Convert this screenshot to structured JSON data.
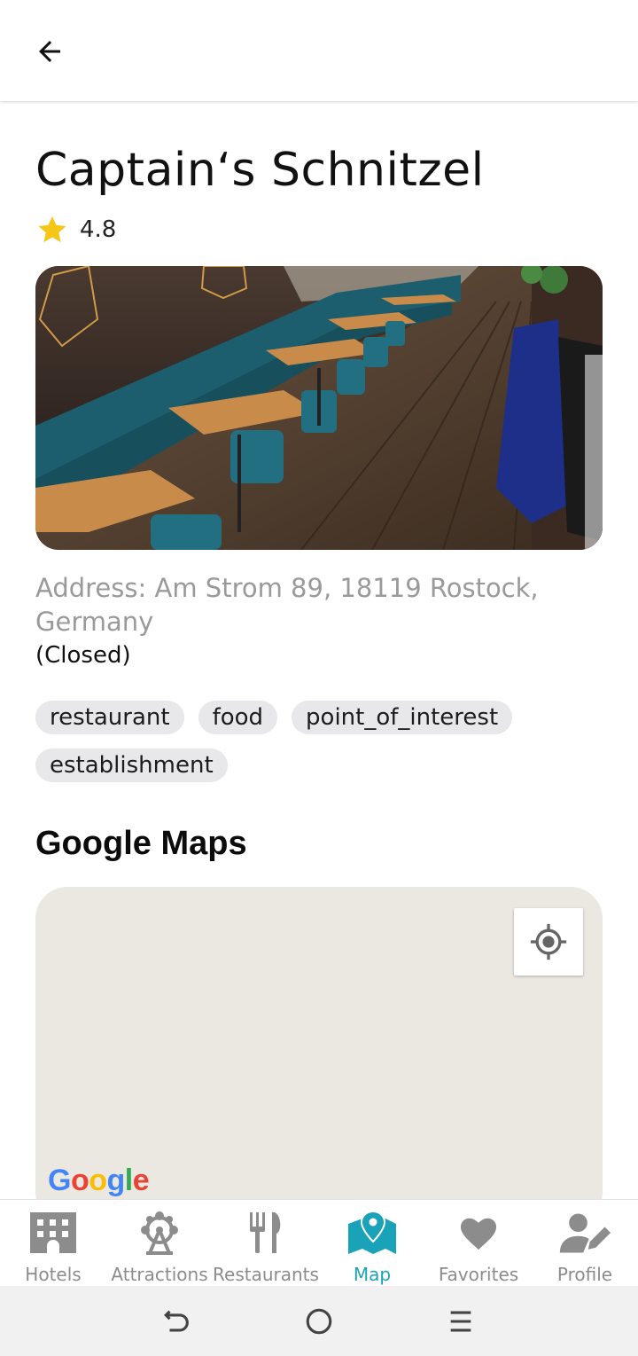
{
  "header": {
    "back_icon": "arrow-left-icon"
  },
  "place": {
    "name": "Captain‘s Schnitzel",
    "rating": "4.8",
    "address": "Address: Am Strom 89, 18119 Rostock, Germany",
    "status": "(Closed)",
    "tags": [
      "restaurant",
      "food",
      "point_of_interest",
      "establishment"
    ]
  },
  "map_section": {
    "title": "Google Maps",
    "logo_letters": [
      "G",
      "o",
      "o",
      "g",
      "l",
      "e"
    ]
  },
  "bottom_nav": [
    {
      "label": "Hotels",
      "icon": "hotel-icon",
      "active": false
    },
    {
      "label": "Attractions",
      "icon": "ferris-wheel-icon",
      "active": false
    },
    {
      "label": "Restaurants",
      "icon": "fork-knife-icon",
      "active": false
    },
    {
      "label": "Map",
      "icon": "map-pin-icon",
      "active": true
    },
    {
      "label": "Favorites",
      "icon": "heart-icon",
      "active": false
    },
    {
      "label": "Profile",
      "icon": "user-edit-icon",
      "active": false
    }
  ],
  "colors": {
    "accent": "#1aa3b8",
    "inactive": "#8c8c8c",
    "star": "#f5c518",
    "map_bg": "#ebe8e1",
    "chip_bg": "#e8e8ea"
  }
}
